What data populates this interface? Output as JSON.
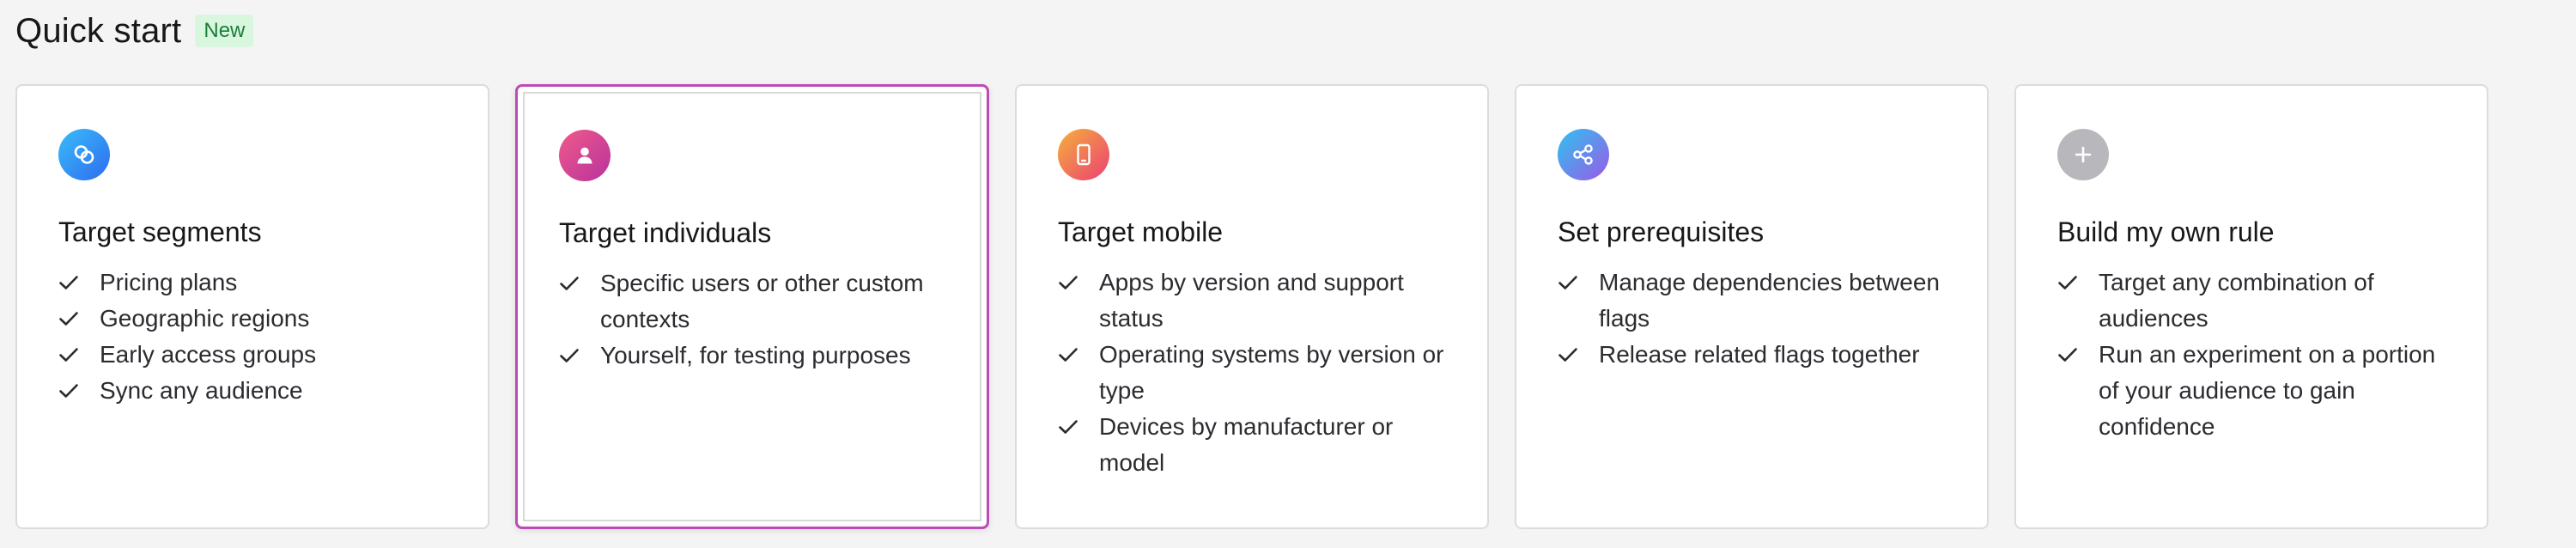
{
  "header": {
    "title": "Quick start",
    "badge": "New"
  },
  "cards": [
    {
      "title": "Target segments",
      "icon": "segments-icon",
      "icon_gradient": [
        "#38bdf8",
        "#2f6bf0"
      ],
      "selected": false,
      "features": [
        "Pricing plans",
        "Geographic regions",
        "Early access groups",
        "Sync any audience"
      ]
    },
    {
      "title": "Target individuals",
      "icon": "user-icon",
      "icon_gradient": [
        "#f05a8a",
        "#b8329d"
      ],
      "selected": true,
      "features": [
        "Specific users or other custom contexts",
        "Yourself, for testing purposes"
      ]
    },
    {
      "title": "Target mobile",
      "icon": "mobile-icon",
      "icon_gradient": [
        "#f5b13c",
        "#ec3f73"
      ],
      "selected": false,
      "features": [
        "Apps by version and support status",
        "Operating systems by version or type",
        "Devices by manufacturer or model"
      ]
    },
    {
      "title": "Set prerequisites",
      "icon": "share-icon",
      "icon_gradient": [
        "#2ec3ef",
        "#9b59e8"
      ],
      "selected": false,
      "features": [
        "Manage dependencies between flags",
        "Release related flags together"
      ]
    },
    {
      "title": "Build my own rule",
      "icon": "plus-icon",
      "icon_gradient": [
        "#b8b8bc",
        "#b8b8bc"
      ],
      "selected": false,
      "features": [
        "Target any combination of audiences",
        "Run an experiment on a portion of your audience to gain confidence"
      ]
    }
  ],
  "colors": {
    "selected_border": "#bd4ab7",
    "badge_bg": "#d9f6df",
    "badge_text": "#1b7f3a"
  }
}
